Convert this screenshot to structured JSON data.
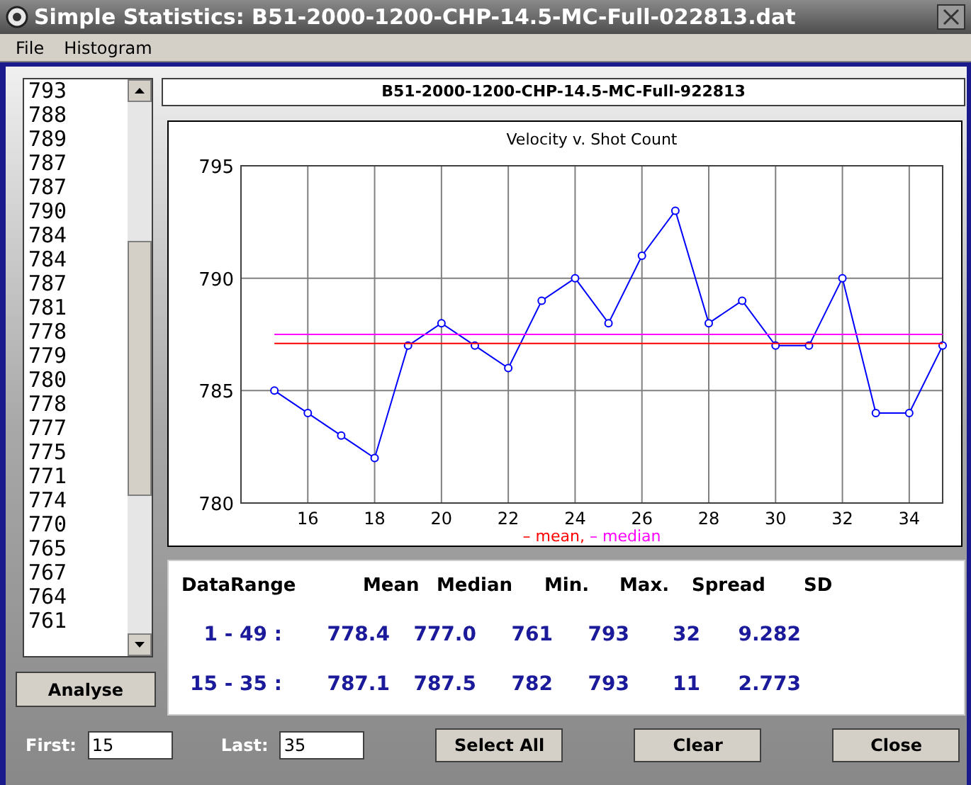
{
  "window": {
    "title": "Simple Statistics: B51-2000-1200-CHP-14.5-MC-Full-022813.dat"
  },
  "menu": [
    "File",
    "Histogram"
  ],
  "velocity_list": {
    "items": [
      "793",
      "788",
      "789",
      "787",
      "787",
      "790",
      "784",
      "784",
      "787",
      "781",
      "778",
      "779",
      "780",
      "778",
      "777",
      "775",
      "771",
      "774",
      "770",
      "765",
      "767",
      "764",
      "761"
    ]
  },
  "analyse_button": "Analyse",
  "file_label": "B51-2000-1200-CHP-14.5-MC-Full-922813",
  "chart": {
    "chart_data": {
      "type": "line",
      "title": "Velocity v. Shot Count",
      "x": [
        15,
        16,
        17,
        18,
        19,
        20,
        21,
        22,
        23,
        24,
        25,
        26,
        27,
        28,
        29,
        30,
        31,
        32,
        33,
        34,
        35
      ],
      "series": [
        {
          "color": "#0000ff",
          "marker": "circle",
          "values": [
            785,
            784,
            783,
            782,
            787,
            788,
            787,
            786,
            789,
            790,
            788,
            791,
            793,
            788,
            789,
            787,
            787,
            790,
            784,
            784,
            787
          ]
        },
        {
          "color": "#ff0000",
          "values": [
            787.1,
            787.1,
            787.1,
            787.1,
            787.1,
            787.1,
            787.1,
            787.1,
            787.1,
            787.1,
            787.1,
            787.1,
            787.1,
            787.1,
            787.1,
            787.1,
            787.1,
            787.1,
            787.1,
            787.1,
            787.1
          ]
        },
        {
          "color": "#ff00ff",
          "values": [
            787.5,
            787.5,
            787.5,
            787.5,
            787.5,
            787.5,
            787.5,
            787.5,
            787.5,
            787.5,
            787.5,
            787.5,
            787.5,
            787.5,
            787.5,
            787.5,
            787.5,
            787.5,
            787.5,
            787.5,
            787.5
          ]
        }
      ],
      "xlim": [
        14,
        35
      ],
      "ylim": [
        780,
        795
      ],
      "xticks": [
        16,
        18,
        20,
        22,
        24,
        26,
        28,
        30,
        32,
        34
      ],
      "yticks": [
        780,
        785,
        790,
        795
      ],
      "grid": true
    },
    "legend": [
      {
        "label": "– mean,",
        "color": "#ff0000"
      },
      {
        "label": "– median",
        "color": "#ff00ff"
      }
    ]
  },
  "stats": {
    "columns": [
      "DataRange",
      "Mean",
      "Median",
      "Min.",
      "Max.",
      "Spread",
      "SD"
    ],
    "rows": [
      [
        "1 - 49 :",
        "778.4",
        "777.0",
        "761",
        "793",
        "32",
        "9.282"
      ],
      [
        "15 - 35 :",
        "787.1",
        "787.5",
        "782",
        "793",
        "11",
        "2.773"
      ]
    ]
  },
  "first": {
    "label": "First:",
    "value": "15"
  },
  "last": {
    "label": "Last:",
    "value": "35"
  },
  "buttons": [
    "Select All",
    "Clear",
    "Close"
  ]
}
